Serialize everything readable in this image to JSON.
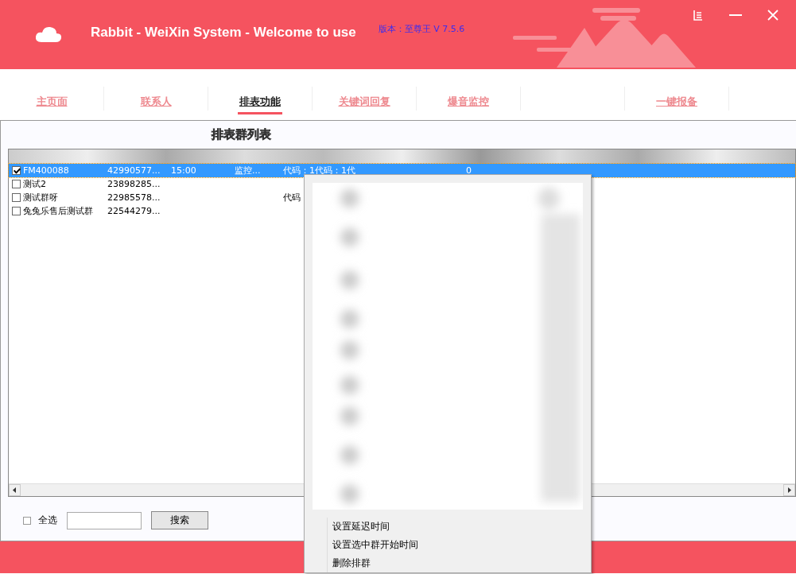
{
  "window": {
    "title": "Rabbit - WeiXin System - Welcome to use",
    "version": "版本：至尊王 V 7.5.6"
  },
  "tabs": [
    {
      "label": "主页面",
      "selected": false
    },
    {
      "label": "联系人",
      "selected": false
    },
    {
      "label": "排表功能",
      "selected": true
    },
    {
      "label": "关键词回复",
      "selected": false
    },
    {
      "label": "爆音监控",
      "selected": false
    },
    {
      "label": "一键报备",
      "selected": false
    }
  ],
  "panel": {
    "title": "排表群列表"
  },
  "rows": [
    {
      "checked": true,
      "selected": true,
      "cells": [
        "FM400088",
        "42990577...",
        "15:00",
        "监控...",
        "代码：1代码：1代",
        "0"
      ]
    },
    {
      "checked": false,
      "selected": false,
      "cells": [
        "测试2",
        "23898285...",
        "",
        "",
        "",
        ""
      ]
    },
    {
      "checked": false,
      "selected": false,
      "cells": [
        "测试群呀",
        "22985578...",
        "",
        "",
        "代码",
        ""
      ]
    },
    {
      "checked": false,
      "selected": false,
      "cells": [
        "兔兔乐售后测试群",
        "22544279...",
        "",
        "",
        "",
        ""
      ]
    }
  ],
  "footer": {
    "select_all": {
      "label": "全选",
      "checked": false
    },
    "search_button": "搜索"
  },
  "context_menu": {
    "items": [
      "设置延迟时间",
      "设置选中群开始时间",
      "删除排群"
    ]
  }
}
